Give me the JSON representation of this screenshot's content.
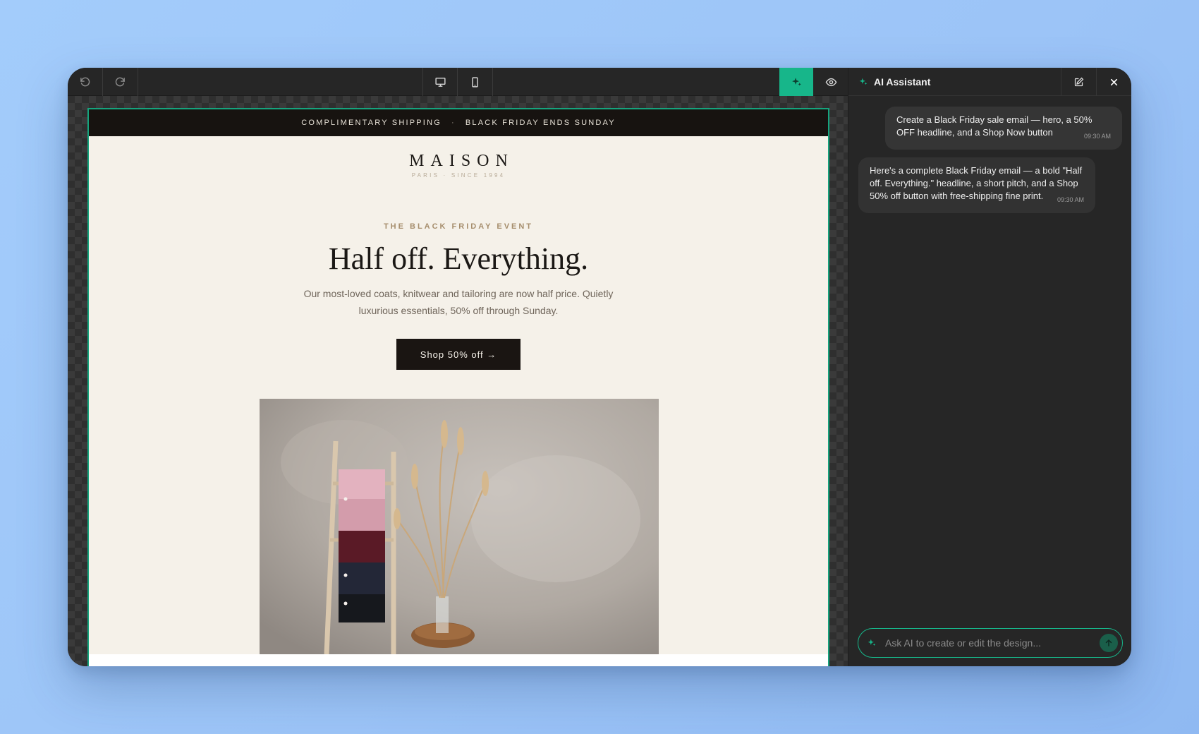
{
  "email": {
    "topbar": {
      "left": "COMPLIMENTARY SHIPPING",
      "separator": "·",
      "right": "BLACK FRIDAY ENDS SUNDAY"
    },
    "brand": {
      "name": "MAISON",
      "sub": "PARIS · SINCE 1994"
    },
    "eyebrow": "THE BLACK FRIDAY EVENT",
    "headline": "Half off. Everything.",
    "pitch": "Our most-loved coats, knitwear and tailoring are now half price. Quietly luxurious essentials, 50% off through Sunday.",
    "cta": "Shop 50% off →"
  },
  "assistant": {
    "title": "AI Assistant",
    "messages": [
      {
        "role": "user",
        "text": "Create a Black Friday sale email — hero, a 50% OFF headline, and a Shop Now button",
        "time": "09:30 AM"
      },
      {
        "role": "assistant",
        "text": "Here's a complete Black Friday email — a bold \"Half off. Everything.\" headline, a short pitch, and a Shop 50% off button with free-shipping fine print.",
        "time": "09:30 AM"
      }
    ],
    "input_placeholder": "Ask AI to create or edit the design..."
  },
  "colors": {
    "accent": "#17b68a",
    "email_bg": "#f5f1e9",
    "dark": "#171310"
  },
  "icons": [
    "undo-icon",
    "redo-icon",
    "desktop-icon",
    "mobile-icon",
    "sparkle-icon",
    "eye-icon",
    "edit-icon",
    "close-icon",
    "send-icon"
  ]
}
